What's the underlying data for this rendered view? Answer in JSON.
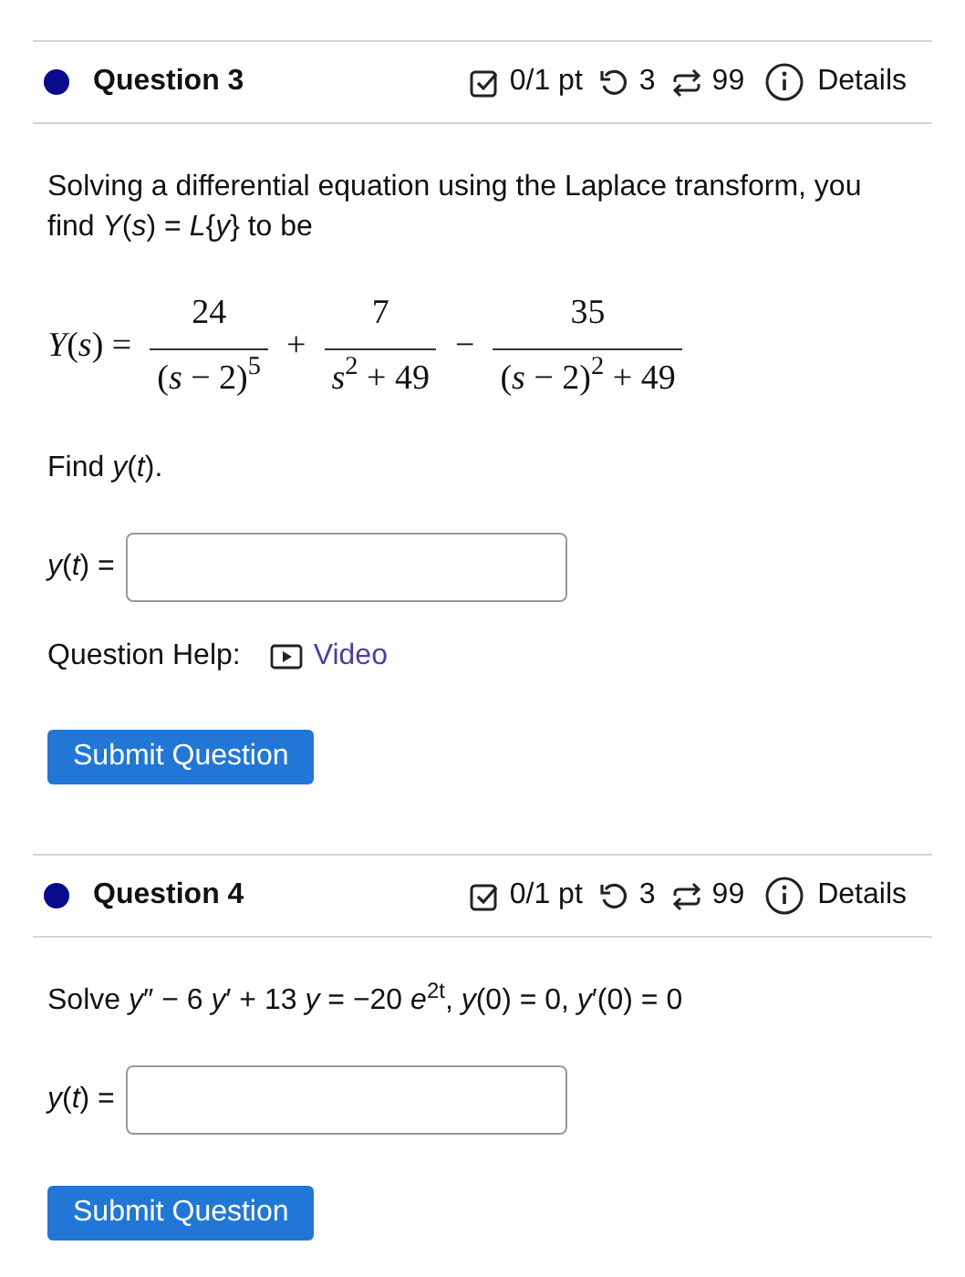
{
  "questions": [
    {
      "header": {
        "title": "Question 3",
        "color": "#0a0a8c",
        "score": "0/1 pt",
        "retries": "3",
        "attempts": "99",
        "details": "Details"
      },
      "parts": [
        {
          "kind": "paragraph",
          "text": "Solving a differential equation using the Laplace transform, you find *Y*(*s*) = *L*{*y*} to be"
        },
        {
          "kind": "equation",
          "lhs": "*Y*(*s*) =",
          "terms": [
            {
              "numerator": "24",
              "denominator": "(*s* − 2)$^{5}$"
            },
            {
              "sign": "+",
              "numerator": "7",
              "denominator": "*s*$^{2}$ + 49"
            },
            {
              "sign": "−",
              "numerator": "35",
              "denominator": "(*s* − 2)$^{2}$ + 49"
            }
          ]
        },
        {
          "kind": "paragraph",
          "text": "Find *y*(*t*)."
        },
        {
          "kind": "answer",
          "label": "*y*(*t*) ="
        },
        {
          "kind": "help",
          "label": "Question Help:",
          "link": "Video"
        },
        {
          "kind": "submit",
          "label": "Submit Question"
        }
      ]
    },
    {
      "header": {
        "title": "Question 4",
        "color": "#0a0a8c",
        "score": "0/1 pt",
        "retries": "3",
        "attempts": "99",
        "details": "Details"
      },
      "parts": [
        {
          "kind": "paragraph",
          "text": "Solve *y*″ − 6 *y*′ + 13 *y* = −20 *e*$^{2t}$, *y*(0) = 0, *y*′(0) = 0"
        },
        {
          "kind": "answer",
          "label": "*y*(*t*) ="
        },
        {
          "kind": "submit",
          "label": "Submit Question"
        }
      ]
    }
  ]
}
